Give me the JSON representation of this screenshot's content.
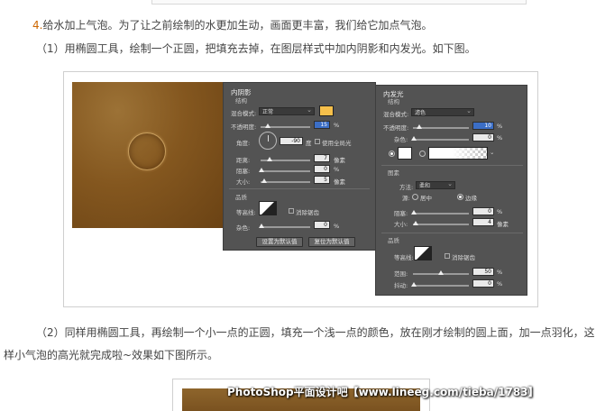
{
  "article": {
    "para1": {
      "step": "4.",
      "text": "给水加上气泡。为了让之前绘制的水更加生动，画面更丰富，我们给它加点气泡。"
    },
    "para2": "（1）用椭圆工具，绘制一个正圆，把填充去掉，在图层样式中加内阴影和内发光。如下图。",
    "para3a": "（2）同样用椭圆工具，再绘制一个小一点的正圆，填充一个浅一点的颜色，放在刚才绘制的圆上面，加一点羽化，这",
    "para3b": "样小气泡的高光就完成啦~效果如下图所示。"
  },
  "inner_shadow": {
    "title": "内阴影",
    "section": "结构",
    "blend_label": "混合模式:",
    "blend_value": "正常",
    "blend_color": "#f7c04b",
    "opacity_label": "不透明度:",
    "opacity_value": "15",
    "angle_label": "角度:",
    "angle_value": "-90",
    "angle_unit": "度",
    "global_light_label": "使用全局光",
    "distance_label": "距离:",
    "distance_value": "7",
    "choke_label": "阻塞:",
    "choke_value": "0",
    "size_label": "大小:",
    "size_value": "5",
    "px_unit": "像素",
    "quality_title": "品质",
    "contour_label": "等高线:",
    "antialias_label": "消除锯齿",
    "noise_label": "杂色:",
    "noise_value": "0",
    "pct": "%",
    "btn_default": "设置为默认值",
    "btn_reset": "复位为默认值"
  },
  "inner_glow": {
    "title": "内发光",
    "section": "结构",
    "blend_label": "混合模式:",
    "blend_value": "滤色",
    "opacity_label": "不透明度:",
    "opacity_value": "10",
    "noise_label": "杂色:",
    "noise_value": "0",
    "pct": "%",
    "elements_title": "图素",
    "method_label": "方法:",
    "method_value": "柔和",
    "source_label": "源:",
    "source_center": "居中",
    "source_edge": "边缘",
    "choke_label": "阻塞:",
    "choke_value": "0",
    "size_label": "大小:",
    "size_value": "4",
    "px_unit": "像素",
    "quality_title": "品质",
    "contour_label": "等高线:",
    "antialias_label": "消除锯齿",
    "range_label": "范围:",
    "range_value": "50",
    "jitter_label": "抖动:",
    "jitter_value": "0"
  },
  "watermark": "PhotoShop平面设计吧【www.lineeg.com/tieba/1783】"
}
